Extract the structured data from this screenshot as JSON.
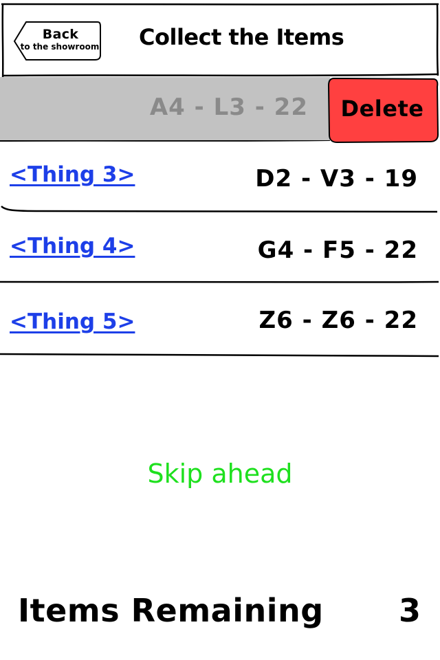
{
  "header": {
    "back_label": "Back",
    "back_sublabel": "to the showroom",
    "title": "Collect the Items"
  },
  "swiped_row": {
    "code": "A4 - L3 - 22",
    "delete_label": "Delete"
  },
  "items": [
    {
      "name": "<Thing 3>",
      "code": "D2 - V3 - 19"
    },
    {
      "name": "<Thing 4>",
      "code": "G4 - F5 - 22"
    },
    {
      "name": "<Thing 5>",
      "code": "Z6 - Z6 - 22"
    }
  ],
  "skip_label": "Skip ahead",
  "footer": {
    "remaining_label": "Items Remaining",
    "remaining_count": "3"
  },
  "colors": {
    "link": "#1d3fe8",
    "delete": "#ff4040",
    "skip": "#1ee01e",
    "swipe_bg": "#c2c2c2"
  }
}
